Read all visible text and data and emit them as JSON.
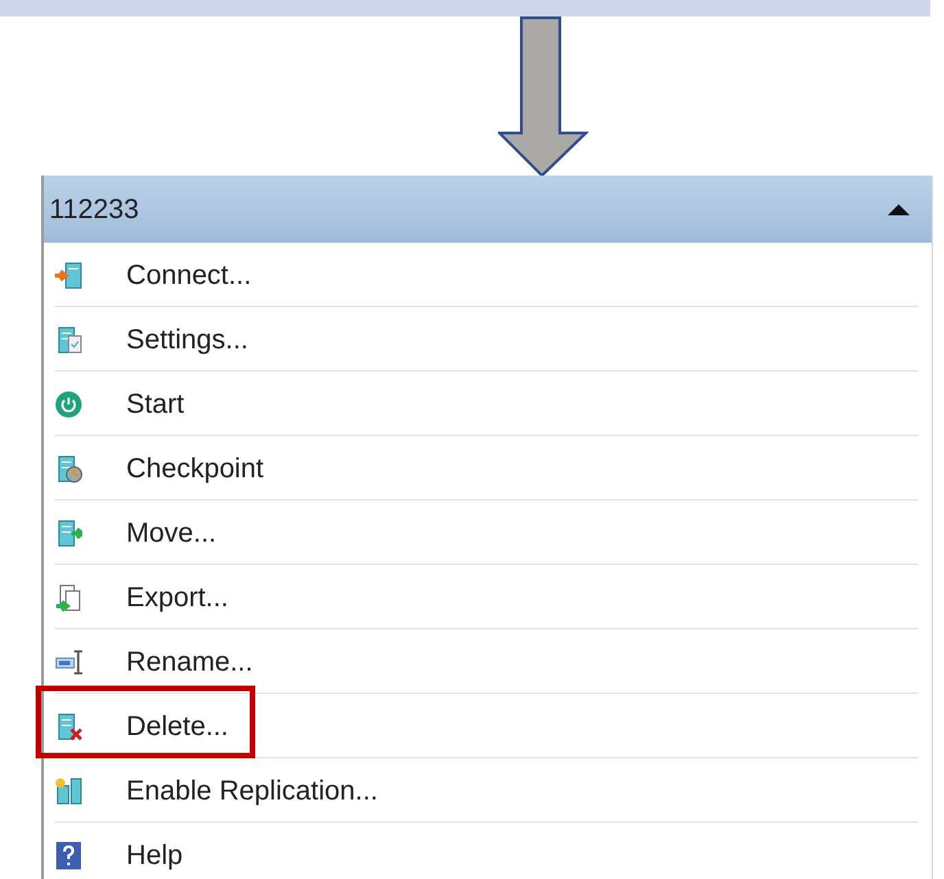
{
  "panel": {
    "title": "112233",
    "expanded": true
  },
  "actions": [
    {
      "label": "Connect...",
      "highlighted": false
    },
    {
      "label": "Settings...",
      "highlighted": false
    },
    {
      "label": "Start",
      "highlighted": false
    },
    {
      "label": "Checkpoint",
      "highlighted": false
    },
    {
      "label": "Move...",
      "highlighted": false
    },
    {
      "label": "Export...",
      "highlighted": false
    },
    {
      "label": "Rename...",
      "highlighted": false
    },
    {
      "label": "Delete...",
      "highlighted": true
    },
    {
      "label": "Enable Replication...",
      "highlighted": false
    },
    {
      "label": "Help",
      "highlighted": false
    }
  ]
}
